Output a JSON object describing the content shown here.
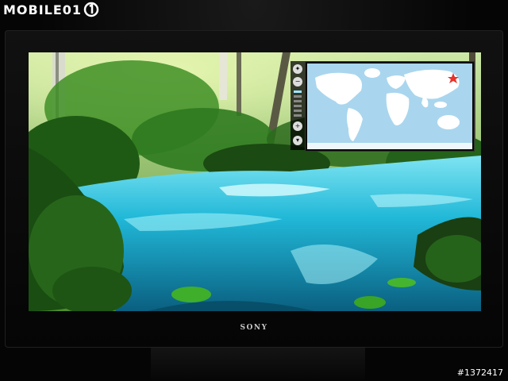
{
  "logo": {
    "text": "MOBILE01"
  },
  "tv": {
    "brand": "SONY"
  },
  "photo_id": "#1372417",
  "map_widget": {
    "toolbar_icons": [
      "pan-icon",
      "zoom-out-icon",
      "zoom-slider",
      "zoom-in-icon",
      "move-icon"
    ],
    "marker": "red-star-marker"
  },
  "colors": {
    "water": "#21b8d8",
    "foliage": "#2f7a1f",
    "map_sea": "#a9d6ee",
    "map_land": "#ffffff",
    "marker": "#e8322a"
  }
}
